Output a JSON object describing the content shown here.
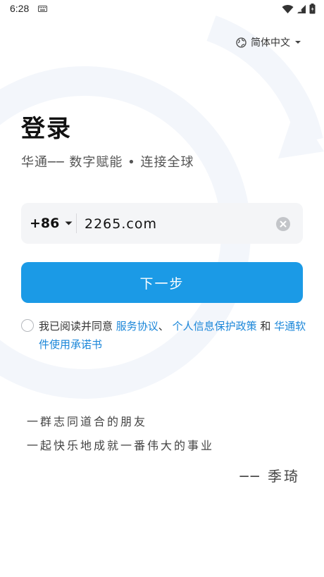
{
  "status_bar": {
    "time": "6:28",
    "icons": [
      "keyboard-icon",
      "wifi-icon",
      "signal-icon",
      "battery-icon"
    ]
  },
  "language": {
    "label": "简体中文",
    "icon": "globe-icon"
  },
  "login": {
    "title": "登录",
    "subtitle": "华通── 数字赋能 • 连接全球"
  },
  "phone": {
    "country_code": "+86",
    "value": "2265.com"
  },
  "next_button": {
    "label": "下一步"
  },
  "agreement": {
    "prefix": "我已阅读并同意 ",
    "service_link": "服务协议",
    "separator": "、 ",
    "privacy_link": "个人信息保护政策",
    "and": " 和 ",
    "software_link": "华通软件使用承诺书"
  },
  "quote": {
    "line1": "一群志同道合的朋友",
    "line2": "一起快乐地成就一番伟大的事业",
    "author": "── 季琦"
  },
  "colors": {
    "accent": "#1b9ae6",
    "link": "#1a86d9",
    "input_bg": "#f4f5f7"
  }
}
